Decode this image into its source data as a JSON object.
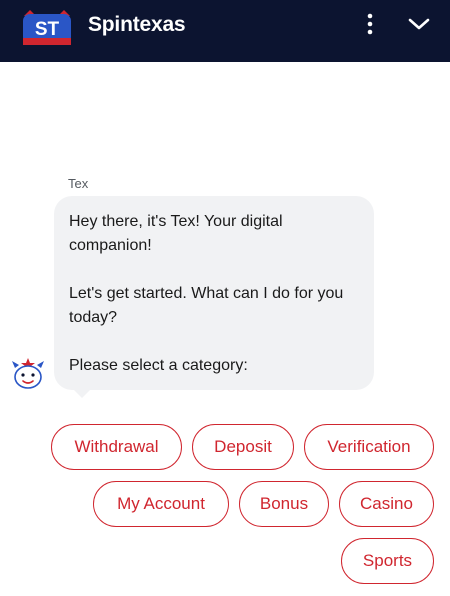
{
  "header": {
    "logo_text": "ST",
    "title": "Spintexas",
    "menu_icon": "more-vertical-icon",
    "collapse_icon": "chevron-down-icon",
    "background": "#0c1430"
  },
  "message": {
    "sender": "Tex",
    "paragraphs": [
      "Hey there, it's Tex! Your digital companion!",
      "Let's get started. What can I do for you today?",
      "Please select a category:"
    ],
    "avatar_icon": "bot-avatar-icon"
  },
  "quick_replies": [
    "Withdrawal",
    "Deposit",
    "Verification",
    "My Account",
    "Bonus",
    "Casino",
    "Sports"
  ],
  "colors": {
    "accent": "#d0262f",
    "bubble": "#f1f2f4"
  }
}
